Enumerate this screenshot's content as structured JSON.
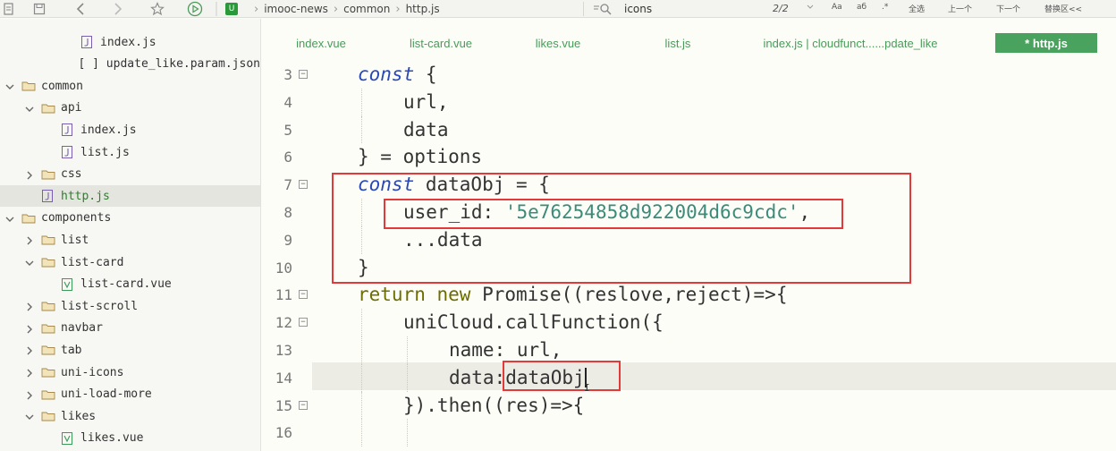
{
  "toolbar": {
    "breadcrumb": [
      "imooc-news",
      "common",
      "http.js"
    ],
    "find": {
      "query": "icons",
      "count": "2/2",
      "options": [
        "Aa",
        "аб",
        ".*",
        "全选",
        "上一个",
        "下一个",
        "替换区<<"
      ]
    },
    "icons": [
      "file-icon",
      "save-icon",
      "back-arrow-icon",
      "forward-arrow-icon",
      "star-icon",
      "run-icon",
      "dropdown-icon"
    ]
  },
  "sidebar": {
    "items": [
      {
        "label": "index.js",
        "type": "file",
        "depth": 3,
        "expanded": null
      },
      {
        "label": "[ ] update_like.param.json",
        "type": "text",
        "depth": 3,
        "expanded": null
      },
      {
        "label": "common",
        "type": "folder",
        "depth": 0,
        "expanded": true
      },
      {
        "label": "api",
        "type": "folder",
        "depth": 1,
        "expanded": true
      },
      {
        "label": "index.js",
        "type": "file",
        "depth": 2,
        "expanded": null
      },
      {
        "label": "list.js",
        "type": "file",
        "depth": 2,
        "expanded": null
      },
      {
        "label": "css",
        "type": "folder",
        "depth": 1,
        "expanded": false
      },
      {
        "label": "http.js",
        "type": "file",
        "depth": 1,
        "expanded": null,
        "selected": true
      },
      {
        "label": "components",
        "type": "folder",
        "depth": 0,
        "expanded": true
      },
      {
        "label": "list",
        "type": "folder",
        "depth": 1,
        "expanded": false
      },
      {
        "label": "list-card",
        "type": "folder",
        "depth": 1,
        "expanded": true
      },
      {
        "label": "list-card.vue",
        "type": "vue",
        "depth": 2,
        "expanded": null
      },
      {
        "label": "list-scroll",
        "type": "folder",
        "depth": 1,
        "expanded": false
      },
      {
        "label": "navbar",
        "type": "folder",
        "depth": 1,
        "expanded": false
      },
      {
        "label": "tab",
        "type": "folder",
        "depth": 1,
        "expanded": false
      },
      {
        "label": "uni-icons",
        "type": "folder",
        "depth": 1,
        "expanded": false
      },
      {
        "label": "uni-load-more",
        "type": "folder",
        "depth": 1,
        "expanded": false
      },
      {
        "label": "likes",
        "type": "folder",
        "depth": 1,
        "expanded": true
      },
      {
        "label": "likes.vue",
        "type": "vue",
        "depth": 2,
        "expanded": null
      }
    ]
  },
  "editor": {
    "tabs": [
      {
        "label": "index.vue",
        "active": false
      },
      {
        "label": "list-card.vue",
        "active": false
      },
      {
        "label": "likes.vue",
        "active": false
      },
      {
        "label": "list.js",
        "active": false
      },
      {
        "label": "index.js | cloudfunct......pdate_like",
        "active": false
      },
      {
        "label": "* http.js",
        "active": true
      }
    ],
    "lines": [
      {
        "num": "3",
        "fold": true,
        "indent": 1,
        "tokens": [
          [
            "kw",
            "const"
          ],
          [
            "punct",
            " {"
          ]
        ]
      },
      {
        "num": "4",
        "fold": false,
        "indent": 2,
        "tokens": [
          [
            "prop",
            "url,"
          ]
        ]
      },
      {
        "num": "5",
        "fold": false,
        "indent": 2,
        "tokens": [
          [
            "prop",
            "data"
          ]
        ]
      },
      {
        "num": "6",
        "fold": false,
        "indent": 1,
        "tokens": [
          [
            "punct",
            "} = options"
          ]
        ]
      },
      {
        "num": "7",
        "fold": true,
        "indent": 1,
        "tokens": [
          [
            "kw",
            "const"
          ],
          [
            "punct",
            " dataObj = {"
          ]
        ]
      },
      {
        "num": "8",
        "fold": false,
        "indent": 2,
        "tokens": [
          [
            "prop",
            "user_id: "
          ],
          [
            "str",
            "'5e76254858d922004d6c9cdc'"
          ],
          [
            "punct",
            ","
          ]
        ]
      },
      {
        "num": "9",
        "fold": false,
        "indent": 2,
        "tokens": [
          [
            "punct",
            "...data"
          ]
        ]
      },
      {
        "num": "10",
        "fold": false,
        "indent": 1,
        "tokens": [
          [
            "punct",
            "}"
          ]
        ]
      },
      {
        "num": "11",
        "fold": true,
        "indent": 1,
        "tokens": [
          [
            "kw2",
            "return"
          ],
          [
            "punct",
            " "
          ],
          [
            "kw2",
            "new"
          ],
          [
            "punct",
            " Promise((reslove,reject)=>{"
          ]
        ]
      },
      {
        "num": "12",
        "fold": true,
        "indent": 2,
        "tokens": [
          [
            "fn",
            "uniCloud.callFunction({"
          ]
        ]
      },
      {
        "num": "13",
        "fold": false,
        "indent": 3,
        "tokens": [
          [
            "prop",
            "name: url,"
          ]
        ]
      },
      {
        "num": "14",
        "fold": false,
        "indent": 3,
        "tokens": [
          [
            "prop",
            "data:dataObj"
          ]
        ],
        "current": true
      },
      {
        "num": "15",
        "fold": true,
        "indent": 2,
        "tokens": [
          [
            "punct",
            "}).then((res)=>{"
          ]
        ]
      },
      {
        "num": "16",
        "fold": false,
        "indent": 3,
        "tokens": []
      }
    ]
  },
  "colors": {
    "highlight_box": "#e23a3a",
    "active_tab": "#49a25d",
    "keyword": "#2a49b8",
    "string": "#3c8a7a",
    "selected_file": "#2f7d2f"
  }
}
